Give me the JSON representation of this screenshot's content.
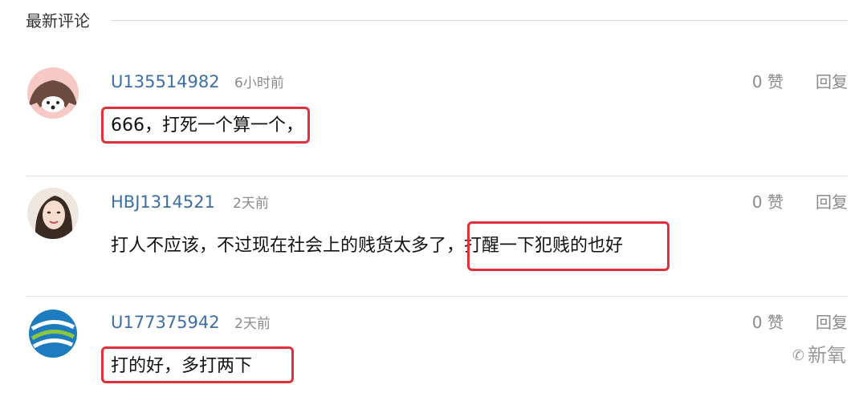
{
  "section": {
    "title": "最新评论"
  },
  "comments": [
    {
      "username": "U135514982",
      "time": "6小时前",
      "text": "666，打死一个算一个，",
      "likes": "0 赞",
      "reply": "回复",
      "avatar": "hedgehog-avatar"
    },
    {
      "username": "HBJ1314521",
      "time": "2天前",
      "text": "打人不应该，不过现在社会上的贱货太多了，打醒一下犯贱的也好",
      "likes": "0 赞",
      "reply": "回复",
      "avatar": "woman-photo-avatar"
    },
    {
      "username": "U177375942",
      "time": "2天前",
      "text": "打的好，多打两下",
      "likes": "0 赞",
      "reply": "回复",
      "avatar": "china-mobile-logo-avatar"
    }
  ],
  "highlight_color": "#e0303a",
  "link_color": "#3e6ea8",
  "watermark": {
    "text": "新氧",
    "icon": "wechat-icon"
  }
}
